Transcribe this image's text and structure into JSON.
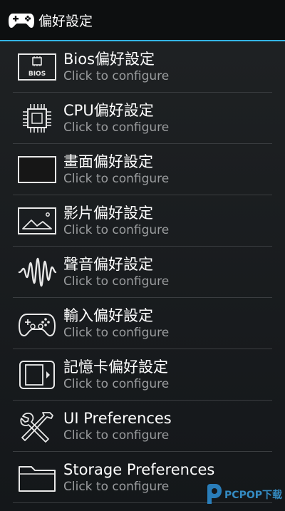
{
  "app_bar": {
    "title": "偏好設定",
    "icon": "gamepad-icon"
  },
  "items": [
    {
      "title": "Bios偏好設定",
      "summary": "Click to configure",
      "icon": "bios-chip-icon",
      "icon_label": "BIOS"
    },
    {
      "title": "CPU偏好設定",
      "summary": "Click to configure",
      "icon": "cpu-icon"
    },
    {
      "title": "畫面偏好設定",
      "summary": "Click to configure",
      "icon": "screen-icon"
    },
    {
      "title": "影片偏好設定",
      "summary": "Click to configure",
      "icon": "picture-icon"
    },
    {
      "title": "聲音偏好設定",
      "summary": "Click to configure",
      "icon": "soundwave-icon"
    },
    {
      "title": "輸入偏好設定",
      "summary": "Click to configure",
      "icon": "gamepad-icon"
    },
    {
      "title": "記憶卡偏好設定",
      "summary": "Click to configure",
      "icon": "memory-card-icon"
    },
    {
      "title": "UI Preferences",
      "summary": "Click to configure",
      "icon": "tools-icon"
    },
    {
      "title": "Storage Preferences",
      "summary": "Click to configure",
      "icon": "folder-icon"
    }
  ],
  "watermark": {
    "text": "PCPOP下载"
  },
  "colors": {
    "accent": "#33b5e5",
    "app_bar_bg": "#0d0f10",
    "summary_text": "#9a9c9e",
    "divider": "#3a3d40"
  }
}
